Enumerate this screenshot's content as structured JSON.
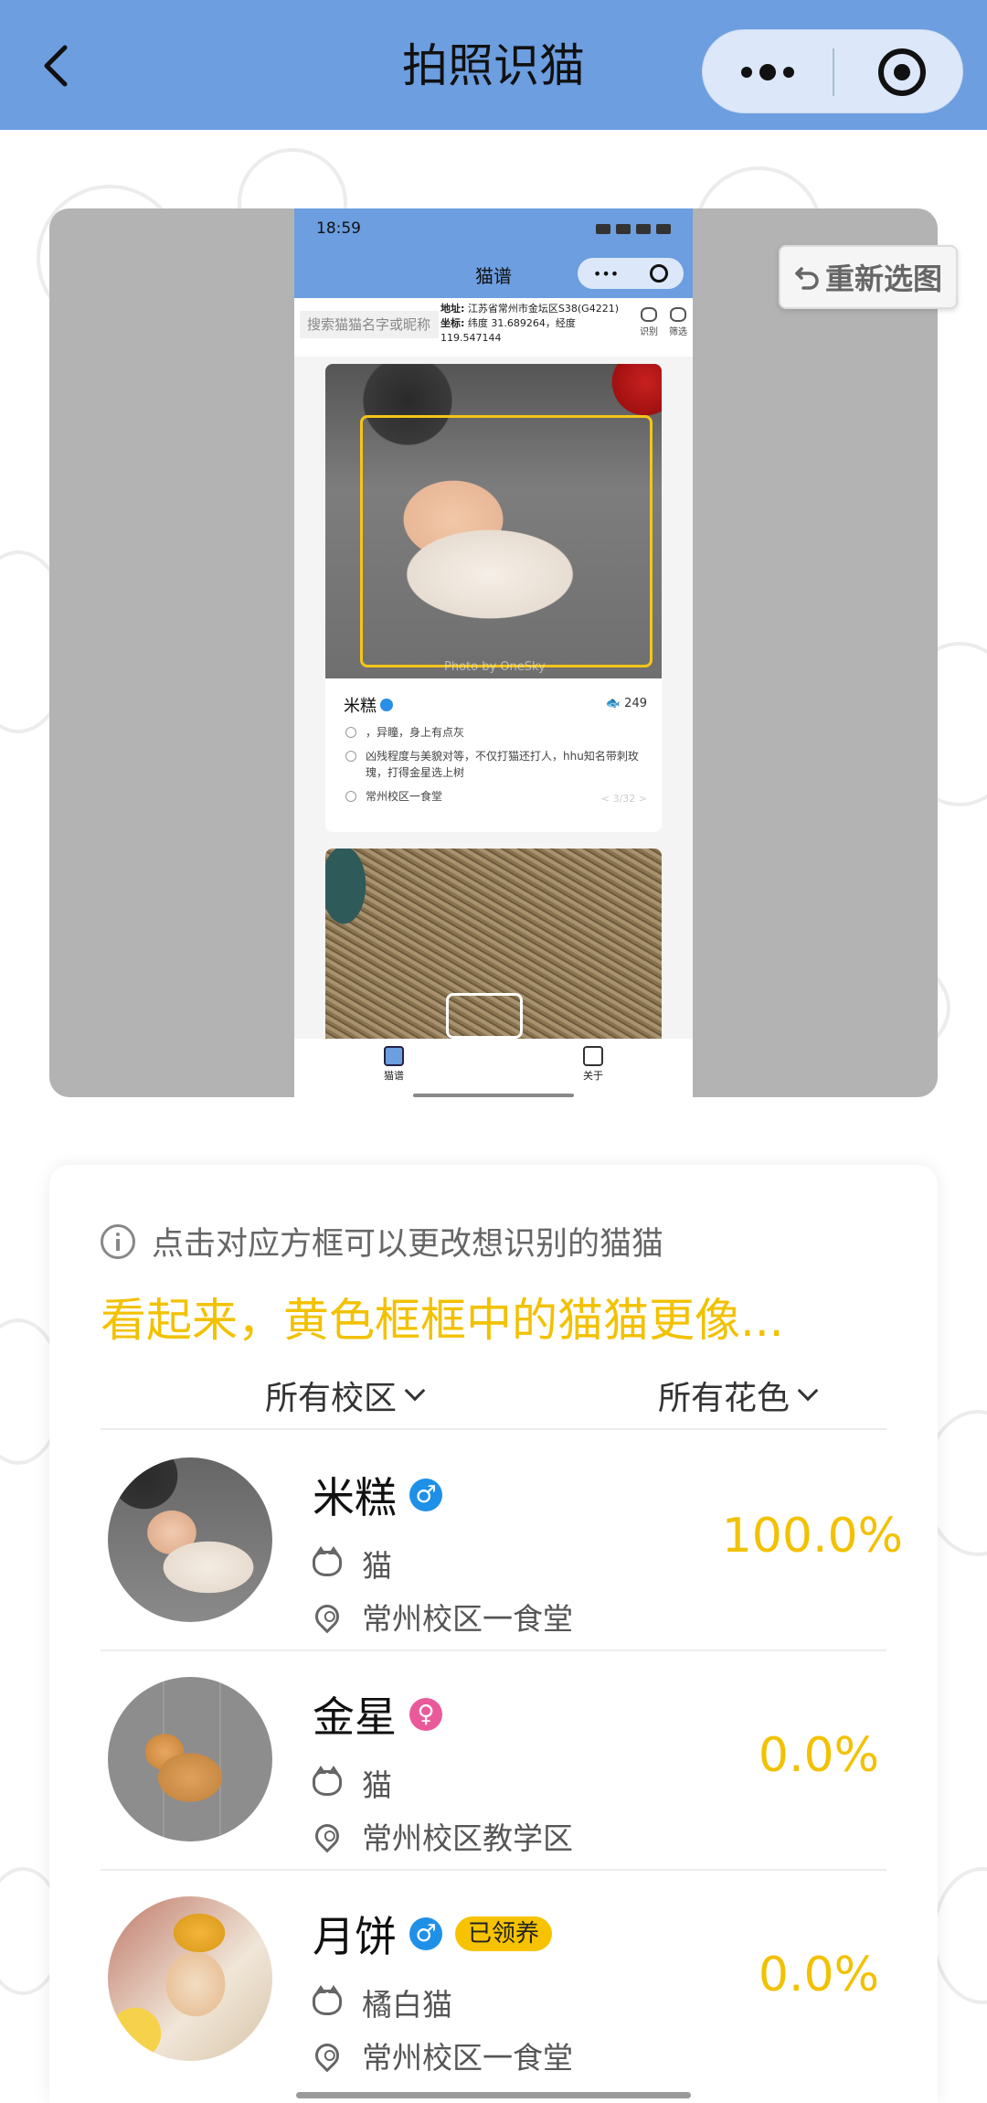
{
  "nav": {
    "title": "拍照识猫"
  },
  "preview": {
    "reselect_label": "重新选图",
    "phone": {
      "time": "18:59",
      "title": "猫谱",
      "search_placeholder": "搜索猫猫名字或昵称",
      "address_label": "地址:",
      "address": "江苏省常州市金坛区S38(G4221)",
      "coords_label": "坐标:",
      "coords": "纬度 31.689264，经度 119.547144",
      "tool_identify": "识别",
      "tool_filter": "筛选",
      "photo_credit": "Photo by OneSky",
      "card": {
        "name": "米糕",
        "likes": "249",
        "line1": "，异瞳，身上有点灰",
        "line2": "凶残程度与美貌对等，不仅打猫还打人，hhu知名带刺玫瑰，打得金星选上树",
        "location": "常州校区一食堂",
        "pager": "< 3/32 >"
      },
      "tabs": [
        "猫谱",
        "关于"
      ]
    }
  },
  "result": {
    "hint": "点击对应方框可以更改想识别的猫猫",
    "headline": "看起来，黄色框框中的猫猫更像...",
    "filter_campus": "所有校区",
    "filter_color": "所有花色",
    "cats": [
      {
        "name": "米糕",
        "gender": "♂",
        "badge": "",
        "breed": "猫",
        "location": "常州校区一食堂",
        "score": "100.0%"
      },
      {
        "name": "金星",
        "gender": "♀",
        "badge": "",
        "breed": "猫",
        "location": "常州校区教学区",
        "score": "0.0%"
      },
      {
        "name": "月饼",
        "gender": "♂",
        "badge": "已领养",
        "breed": "橘白猫",
        "location": "常州校区一食堂",
        "score": "0.0%"
      }
    ]
  },
  "colors": {
    "nav_bg": "#6c9ee0",
    "accent_yellow": "#f2c100",
    "male": "#1e90e8",
    "female": "#ea5a9a"
  },
  "icons": [
    "back-chevron-icon",
    "more-dots-icon",
    "target-close-icon",
    "undo-arrow-icon",
    "info-icon",
    "chevron-down-icon",
    "cat-face-icon",
    "location-pin-icon",
    "male-icon",
    "female-icon"
  ]
}
